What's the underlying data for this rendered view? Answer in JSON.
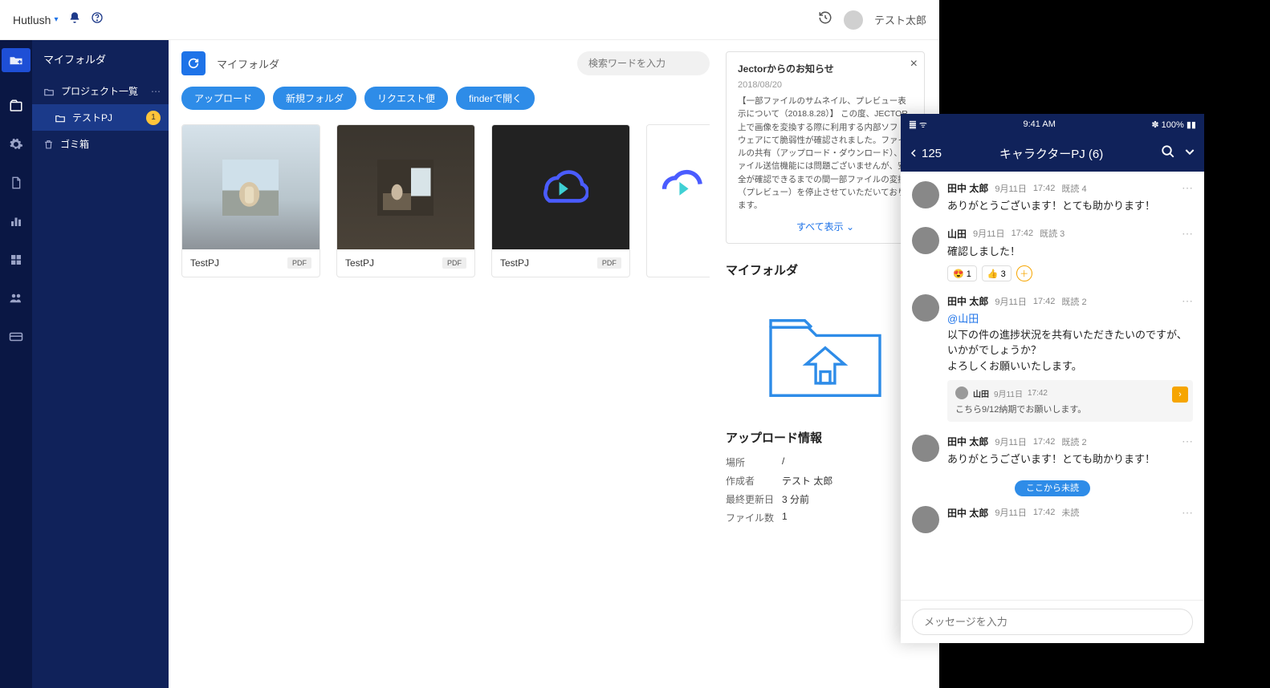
{
  "header": {
    "brand": "Hutlush",
    "username": "テスト太郎"
  },
  "sidebar": {
    "title": "マイフォルダ",
    "project_list": "プロジェクト一覧",
    "test_pj": "テストPJ",
    "test_pj_badge": "1",
    "trash": "ゴミ箱"
  },
  "content": {
    "breadcrumb": "マイフォルダ",
    "search_placeholder": "検索ワードを入力",
    "actions": {
      "upload": "アップロード",
      "new_folder": "新規フォルダ",
      "request": "リクエスト便",
      "finder": "finderで開く"
    },
    "cards": [
      {
        "title": "TestPJ",
        "tag": "PDF"
      },
      {
        "title": "TestPJ",
        "tag": "PDF"
      },
      {
        "title": "TestPJ",
        "tag": "PDF"
      }
    ]
  },
  "notice": {
    "heading": "Jectorからのお知らせ",
    "date": "2018/08/20",
    "body": "【一部ファイルのサムネイル、プレビュー表示について（2018.8.28）】\nこの度、JECTOR 上で画像を変換する際に利用する内部ソフトウェアにて脆弱性が確認されました。ファイルの共有（アップロード・ダウンロード）、ファイル送信機能には問題ございませんが、安全が確認できるまでの間一部ファイルの変換（プレビュー）を停止させていただいております。",
    "more": "すべて表示"
  },
  "myfolder_section": "マイフォルダ",
  "upload_info": {
    "heading": "アップロード情報",
    "rows": [
      {
        "k": "場所",
        "v": "/"
      },
      {
        "k": "作成者",
        "v": "テスト 太郎"
      },
      {
        "k": "最終更新日",
        "v": "3 分前"
      },
      {
        "k": "ファイル数",
        "v": "1"
      }
    ]
  },
  "mobile": {
    "status_time": "9:41 AM",
    "status_battery": "100%",
    "back_count": "125",
    "title": "キャラクターPJ (6)",
    "input_placeholder": "メッセージを入力",
    "unread_divider": "ここから未読",
    "messages": [
      {
        "name": "田中 太郎",
        "date": "9月11日",
        "time": "17:42",
        "read": "既読 4",
        "text": "ありがとうございます！とても助かります！"
      },
      {
        "name": "山田",
        "date": "9月11日",
        "time": "17:42",
        "read": "既読 3",
        "text": "確認しました！",
        "reactions": [
          {
            "emoji": "😍",
            "n": "1"
          },
          {
            "emoji": "👍",
            "n": "3"
          }
        ]
      },
      {
        "name": "田中 太郎",
        "date": "9月11日",
        "time": "17:42",
        "read": "既読 2",
        "mention": "@山田",
        "text": "以下の件の進捗状況を共有いただきたいのですが、いかがでしょうか？\nよろしくお願いいたします。",
        "quote": {
          "name": "山田",
          "date": "9月11日",
          "time": "17:42",
          "text": "こちら9/12納期でお願いします。"
        }
      },
      {
        "name": "田中 太郎",
        "date": "9月11日",
        "time": "17:42",
        "read": "既読 2",
        "text": "ありがとうございます！とても助かります！"
      },
      {
        "name": "田中 太郎",
        "date": "9月11日",
        "time": "17:42",
        "read": "未読",
        "text": ""
      }
    ]
  }
}
